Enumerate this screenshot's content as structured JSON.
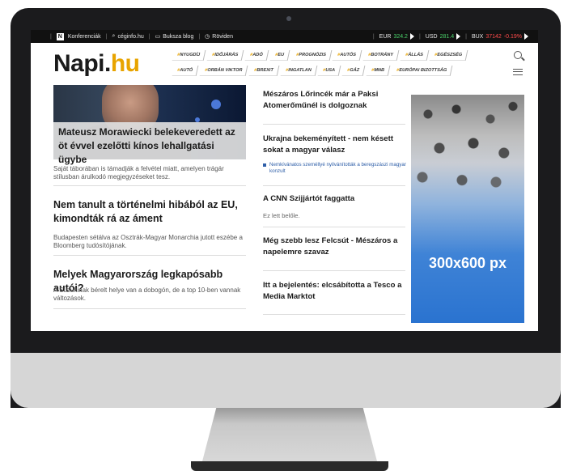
{
  "topbar": {
    "conferences": "Konferenciák",
    "cegnfo": "céginfo.hu",
    "blog": "Buksza blog",
    "briefly": "Röviden",
    "eur_label": "EUR",
    "eur_value": "324.2",
    "usd_label": "USD",
    "usd_value": "281.4",
    "bux_label": "BUX",
    "bux_value": "37142",
    "bux_change": "-0.19%"
  },
  "logo": {
    "main": "Napi.",
    "accent": "hu"
  },
  "tags_row1": [
    "NYUGDÍJ",
    "IDŐJÁRÁS",
    "ADÓ",
    "EU",
    "PROGNÓZIS",
    "AUTÓS",
    "BOTRÁNY",
    "ÁLLÁS",
    "EGÉSZSÉG"
  ],
  "tags_row2": [
    "AUTÓ",
    "ORBÁN VIKTOR",
    "BREXIT",
    "INGATLAN",
    "USA",
    "GÁZ",
    "MNB",
    "EURÓPAI BIZOTTSÁG"
  ],
  "left": {
    "hero_title": "Mateusz Morawiecki belekeveredett az öt évvel ezelőtti kínos lehallgatási ügybe",
    "hero_lead": "Saját táborában is támadják a felvétel miatt, amelyen trágár stílusban árulkodó megjegyzéseket tesz.",
    "a2_title": "Nem tanult a történelmi hibából az EU, kimondták rá az áment",
    "a2_lead": "Budapesten sétálva az Osztrák-Magyar Monarchia jutott eszébe a Bloomberg tudósítójának.",
    "a3_title": "Melyek Magyarország legkapósabb autói?",
    "a3_lead": "A Suzukinak bérelt helye van a dobogón, de a top 10-ben vannak változások."
  },
  "middle": {
    "m1": "Mészáros Lőrincék már a Paksi Atomerőműnél is dolgoznak",
    "m2": "Ukrajna bekeményített - nem késett sokat a magyar válasz",
    "m2_bullet": "Nemkívánatos személlyé nyilvánították a beregszászi magyar konzult",
    "m3": "A CNN Szijjártót faggatta",
    "m3_sub": "Ez lett belőle.",
    "m4": "Még szebb lesz Felcsút - Mészáros a napelemre szavaz",
    "m5": "Itt a bejelentés: elcsábította a Tesco a Media Marktot"
  },
  "ad": {
    "label": "300x600 px"
  },
  "colors": {
    "accent": "#e8a400",
    "up": "#4bd36b",
    "down": "#ff4b4b",
    "link": "#2f5fa8"
  }
}
